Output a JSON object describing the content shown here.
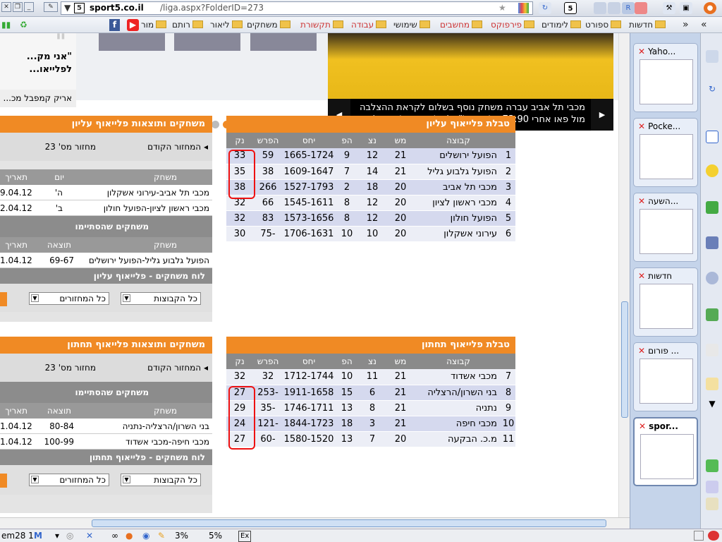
{
  "browser": {
    "url_domain": "sport5.co.il",
    "url_path": "/liga.aspx?FolderID=273",
    "site_badge": "5",
    "bookmarks": [
      "חדשות",
      "ספורט",
      "לימודים",
      "פירפוקס",
      "מחשבים",
      "שימושי",
      "עבודה",
      "תקשורת",
      "משחקים",
      "ליאור",
      "רותם",
      "מור"
    ]
  },
  "article": {
    "quote_text": "\"אני מק... לפלייאו...",
    "author": "אריק קמפבל מכ...",
    "caption": "מכבי תל אביב עברה משחק נוסף בשלום לקראת ההצלבה מול פאו אחרי 73:90 על ראשל\"צ (צילומים: אלן שיבר)",
    "prev": "◀",
    "next": "▶"
  },
  "upper": {
    "title": "טבלת פלייאוף עליון",
    "headers": [
      "",
      "קבוצה",
      "מש",
      "נצ",
      "הפ",
      "יחס",
      "הפרש",
      "נק"
    ],
    "rows": [
      [
        "1",
        "הפועל ירושלים",
        "21",
        "12",
        "9",
        "1665-1724",
        "59",
        "33"
      ],
      [
        "2",
        "הפועל גלבוע גליל",
        "21",
        "14",
        "7",
        "1609-1647",
        "38",
        "35"
      ],
      [
        "3",
        "מכבי תל אביב",
        "20",
        "18",
        "2",
        "1527-1793",
        "266",
        "38"
      ],
      [
        "4",
        "מכבי ראשון לציון",
        "20",
        "12",
        "8",
        "1545-1611",
        "66",
        "32"
      ],
      [
        "5",
        "הפועל חולון",
        "20",
        "12",
        "8",
        "1573-1656",
        "83",
        "32"
      ],
      [
        "6",
        "עירוני אשקלון",
        "20",
        "10",
        "10",
        "1706-1631",
        "-75",
        "30"
      ]
    ]
  },
  "lower": {
    "title": "טבלת פלייאוף תחתון",
    "headers": [
      "",
      "קבוצה",
      "מש",
      "נצ",
      "הפ",
      "יחס",
      "הפרש",
      "נק"
    ],
    "rows": [
      [
        "7",
        "מכבי אשדוד",
        "21",
        "11",
        "10",
        "1712-1744",
        "32",
        "32"
      ],
      [
        "8",
        "בני השרון/הרצליה",
        "21",
        "6",
        "15",
        "1911-1658",
        "-253",
        "27"
      ],
      [
        "9",
        "נתניה",
        "21",
        "8",
        "13",
        "1746-1711",
        "-35",
        "29"
      ],
      [
        "10",
        "מכבי חיפה",
        "21",
        "3",
        "18",
        "1844-1723",
        "-121",
        "24"
      ],
      [
        "11",
        "מ.כ. הבקעה",
        "20",
        "7",
        "13",
        "1580-1520",
        "-60",
        "27"
      ]
    ]
  },
  "games_upper": {
    "title": "משחקים ותוצאות פלייאוף עליון",
    "prev_round": "◂ המחזור הקודם",
    "round": "מחזור מס' 23",
    "col_game": "משחק",
    "col_day": "יום",
    "col_date": "תאריך",
    "fixtures": [
      [
        "מכבי תל אביב-עירוני אשקלון",
        "ה'",
        "9.04.12"
      ],
      [
        "מכבי ראשון לציון-הפועל חולון",
        "ב'",
        "2.04.12"
      ]
    ],
    "finished_title": "משחקים שהסתיימו",
    "col_result": "תוצאה",
    "results": [
      [
        "הפועל גלבוע גליל-הפועל ירושלים",
        "69-67",
        "1.04.12"
      ]
    ],
    "schedule_title": "לוח משחקים - פלייאוף עליון",
    "sel_teams": "כל הקבוצות",
    "sel_rounds": "כל המחזורים"
  },
  "games_lower": {
    "title": "משחקים ותוצאות פלייאוף תחתון",
    "prev_round": "◂ המחזור הקודם",
    "round": "מחזור מס' 23",
    "finished_title": "משחקים שהסתיימו",
    "col_game": "משחק",
    "col_result": "תוצאה",
    "col_date": "תאריך",
    "results": [
      [
        "בני השרון/הרצליה-נתניה",
        "80-84",
        "1.04.12"
      ],
      [
        "מכבי חיפה-מכבי אשדוד",
        "100-99",
        "1.04.12"
      ]
    ],
    "schedule_title": "לוח משחקים - פלייאוף תחתון",
    "sel_teams": "כל הקבוצות",
    "sel_rounds": "כל המחזורים"
  },
  "tabs": [
    {
      "title": "Yaho..."
    },
    {
      "title": "Pocke..."
    },
    {
      "title": "השעה..."
    },
    {
      "title": "חדשות"
    },
    {
      "title": "פורום ..."
    },
    {
      "title": "spor..."
    }
  ],
  "status": {
    "left": "em28 1",
    "cpu1": "3%",
    "cpu2": "5%",
    "ex": "Ex"
  }
}
